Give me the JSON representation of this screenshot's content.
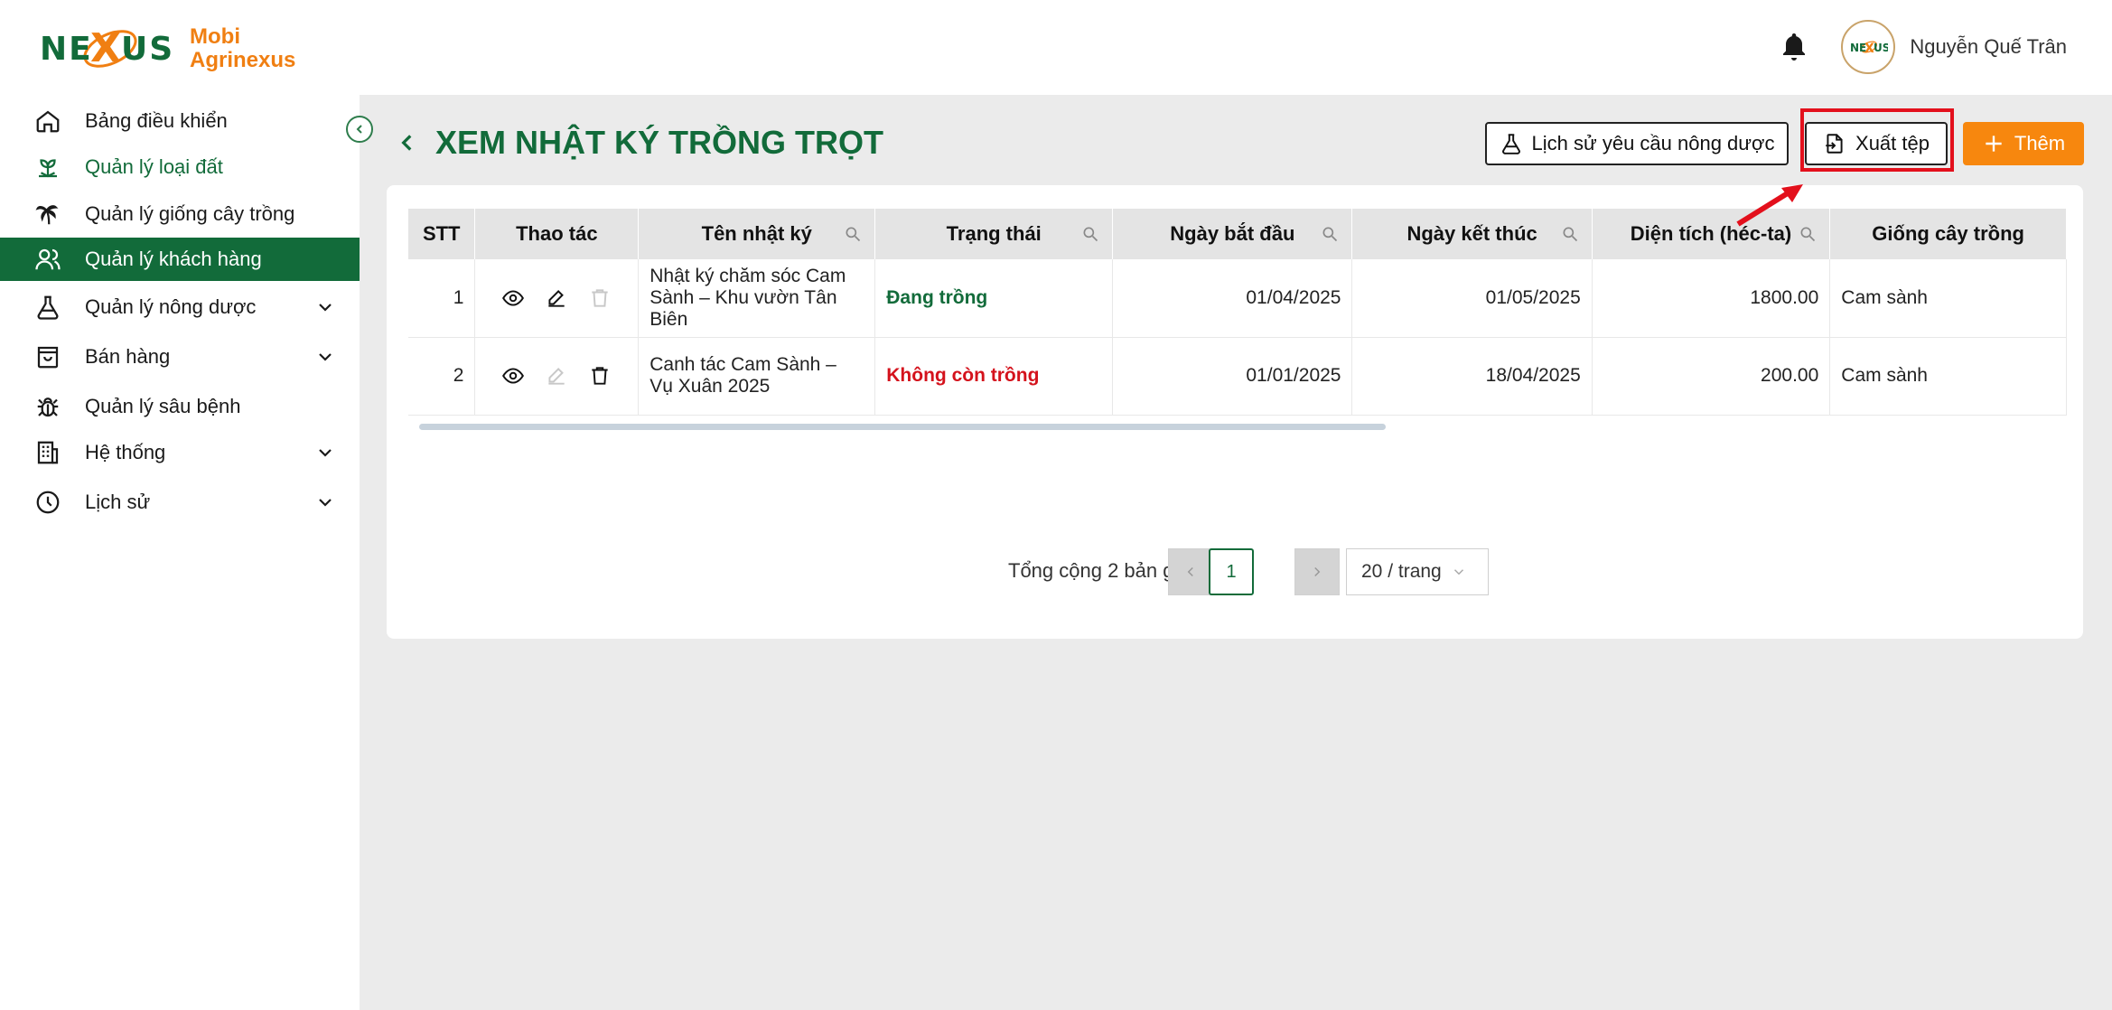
{
  "app": {
    "logo_text_line1": "Mobi",
    "logo_text_line2": "Agrinexus",
    "logo_mark_text": "NEXUS"
  },
  "header": {
    "user_name": "Nguyễn Quế Trân",
    "avatar_text": "NEXUS"
  },
  "sidebar": {
    "items": [
      {
        "label": "Bảng điều khiển",
        "icon": "home-icon"
      },
      {
        "label": "Quản lý loại đất",
        "icon": "sprout-icon"
      },
      {
        "label": "Quản lý giống cây trồng",
        "icon": "palm-tree-icon"
      },
      {
        "label": "Quản lý khách hàng",
        "icon": "users-icon"
      },
      {
        "label": "Quản lý nông dược",
        "icon": "flask-icon"
      },
      {
        "label": "Bán hàng",
        "icon": "shopping-bag-icon"
      },
      {
        "label": "Quản lý sâu bệnh",
        "icon": "bug-icon"
      },
      {
        "label": "Hệ thống",
        "icon": "building-icon"
      },
      {
        "label": "Lịch sử",
        "icon": "clock-icon"
      }
    ]
  },
  "page": {
    "title": "XEM NHẬT KÝ TRỒNG TRỌT",
    "buttons": {
      "history": "Lịch sử yêu cầu nông dược",
      "export": "Xuất tệp",
      "add": "Thêm"
    }
  },
  "table": {
    "columns": [
      "STT",
      "Thao tác",
      "Tên nhật ký",
      "Trạng thái",
      "Ngày bắt đầu",
      "Ngày kết thúc",
      "Diện tích (héc-ta)",
      "Giống cây trồng"
    ],
    "rows": [
      {
        "stt": "1",
        "name": "Nhật ký chăm sóc Cam Sành – Khu vườn Tân Biên",
        "status": "Đang trồng",
        "start": "01/04/2025",
        "end": "01/05/2025",
        "area": "1800.00",
        "variety": "Cam sành"
      },
      {
        "stt": "2",
        "name": "Canh tác Cam Sành – Vụ Xuân 2025",
        "status": "Không còn trồng",
        "start": "01/01/2025",
        "end": "18/04/2025",
        "area": "200.00",
        "variety": "Cam sành"
      }
    ]
  },
  "pagination": {
    "total": "Tổng cộng 2 bản ghi",
    "current_page": "1",
    "page_size": "20 / trang"
  },
  "colors": {
    "brand_green": "#126b3a",
    "brand_orange": "#f7870e",
    "status_active": "#126b3a",
    "status_inactive": "#d4121c",
    "highlight_red": "#e3101c"
  }
}
